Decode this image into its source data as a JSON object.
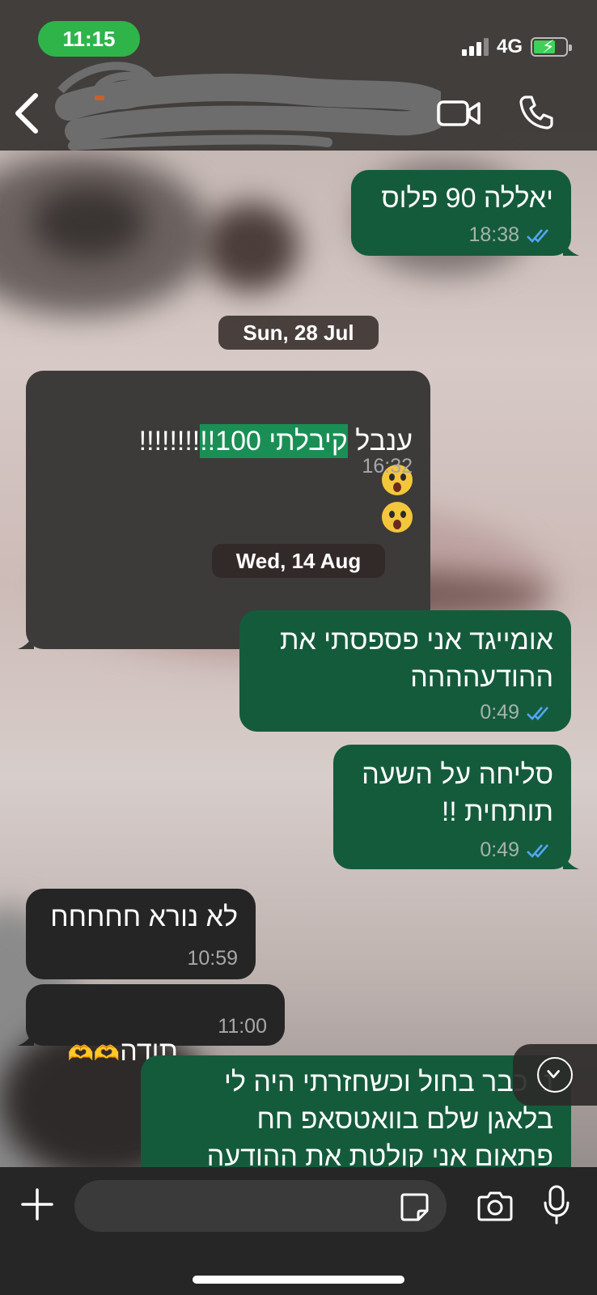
{
  "status_bar": {
    "time": "11:15",
    "network": "4G"
  },
  "header": {
    "contact_name": ""
  },
  "icons": {
    "back": "chevron-left-icon",
    "video": "video-camera-icon",
    "call": "phone-icon",
    "plus": "plus-icon",
    "sticker": "sticker-icon",
    "camera": "camera-icon",
    "mic": "microphone-icon",
    "scroll": "chevron-down-icon"
  },
  "colors": {
    "outgoing": "#145b3c",
    "incoming": "#3c3b3a",
    "read_ticks": "#53a6f5",
    "accent": "#2fb44a"
  },
  "messages": {
    "m1": {
      "text": "יאללה 90 פלוס",
      "time": "18:38"
    },
    "date1": "Sun, 28 Jul",
    "m2": {
      "pre": "ענבל ",
      "hl": "קיבלתי 100!!",
      "post": "!!!!!!!!",
      "time": "16:32"
    },
    "date2": "Wed, 14 Aug",
    "m3": {
      "text": "אומייגד אני פספסתי את\nההודעהההה",
      "time": "0:49"
    },
    "m4": {
      "text": "סליחה על השעה\nתותחית !!",
      "time": "0:49"
    },
    "m5": {
      "text": "לא נורא חחחחח",
      "time": "10:59"
    },
    "m6": {
      "text": "תודה",
      "time": "11:00"
    },
    "m7": {
      "text": "ני כבר בחול וכשחזרתי היה לי\nבלאגן שלם בוואטסאפ חח\nפתאום אני קולטת את ההודעה"
    }
  }
}
